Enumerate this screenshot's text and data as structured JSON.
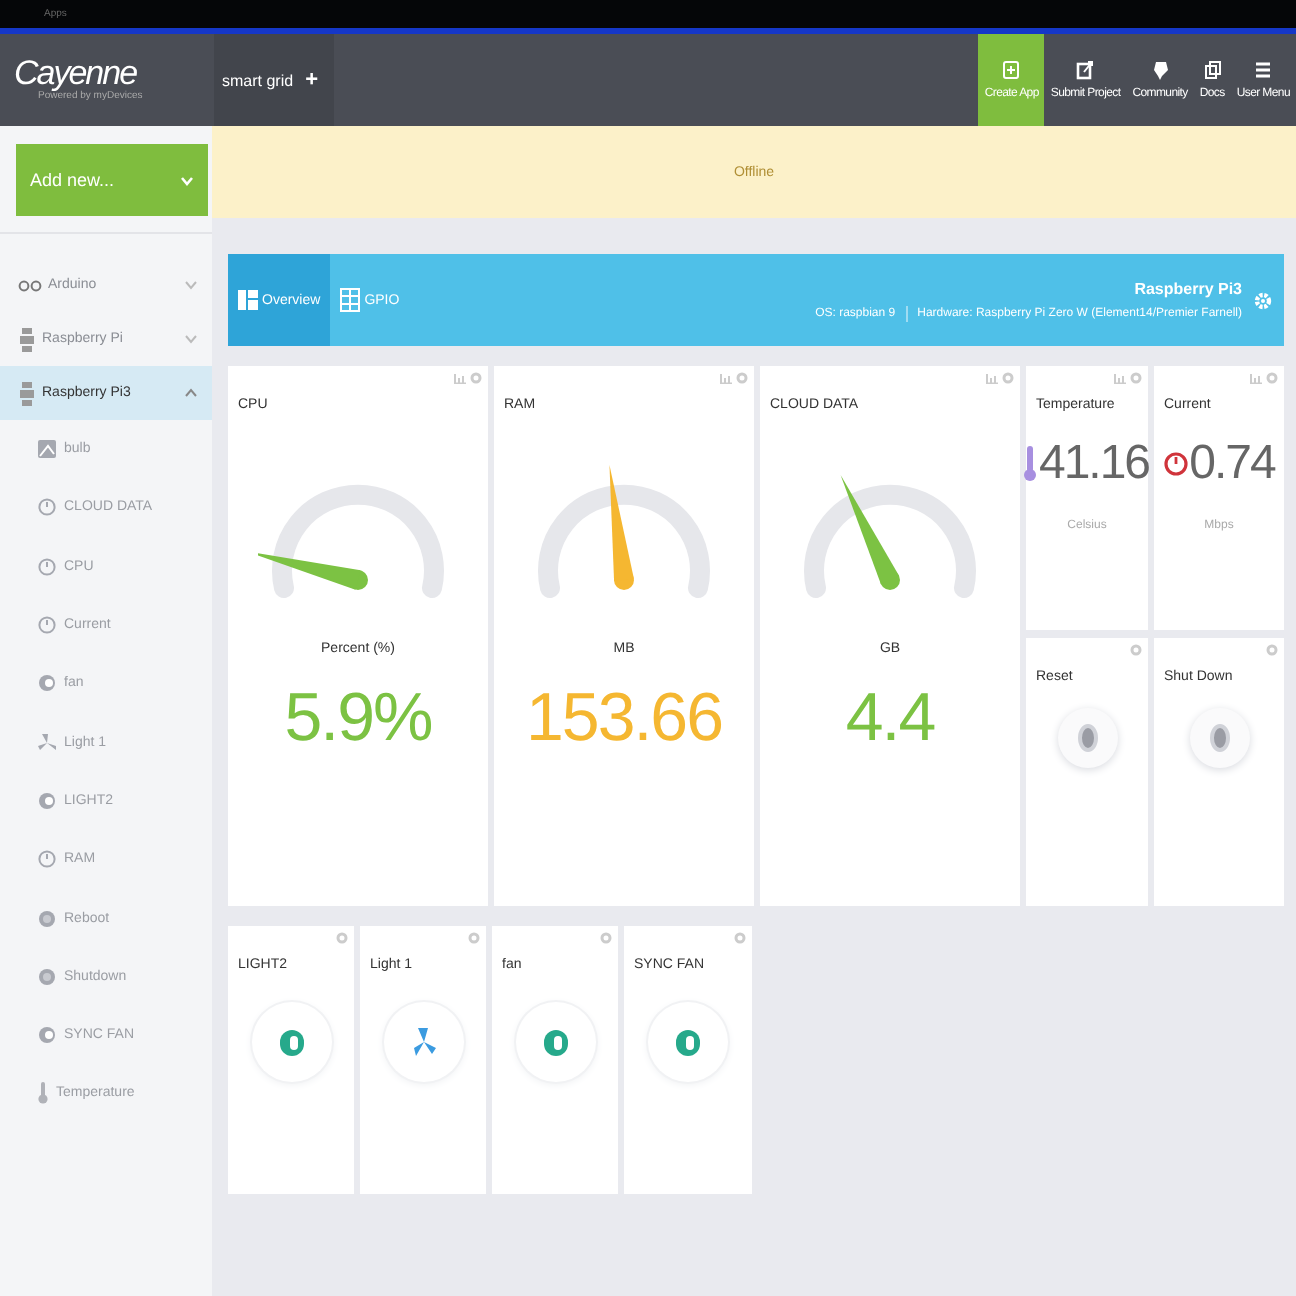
{
  "top_bar": {
    "label": "Apps"
  },
  "header": {
    "logo": "Cayenne",
    "tagline": "Powered by myDevices",
    "project_tab": "smart grid",
    "add_symbol": "+",
    "nav": [
      {
        "label": "Create App",
        "kind": "create",
        "selected": true
      },
      {
        "label": "Submit Project",
        "kind": "submit",
        "selected": false
      },
      {
        "label": "Community",
        "kind": "community",
        "selected": false
      },
      {
        "label": "Docs",
        "kind": "docs",
        "selected": false
      },
      {
        "label": "User Menu",
        "kind": "menu",
        "selected": false
      }
    ]
  },
  "sidebar": {
    "add_button": "Add new...",
    "devices": [
      {
        "name": "Arduino",
        "kind": "arduino",
        "expanded": false,
        "selected": false
      },
      {
        "name": "Raspberry Pi",
        "kind": "raspberry",
        "expanded": false,
        "selected": false
      },
      {
        "name": "Raspberry Pi3",
        "kind": "raspberry",
        "expanded": true,
        "selected": true,
        "children": [
          {
            "name": "bulb",
            "kind": "image"
          },
          {
            "name": "CLOUD DATA",
            "kind": "dial"
          },
          {
            "name": "CPU",
            "kind": "dial"
          },
          {
            "name": "Current",
            "kind": "dial"
          },
          {
            "name": "fan",
            "kind": "toggle"
          },
          {
            "name": "Light 1",
            "kind": "fan"
          },
          {
            "name": "LIGHT2",
            "kind": "toggle"
          },
          {
            "name": "RAM",
            "kind": "dial"
          },
          {
            "name": "Reboot",
            "kind": "button"
          },
          {
            "name": "Shutdown",
            "kind": "button"
          },
          {
            "name": "SYNC FAN",
            "kind": "toggle"
          },
          {
            "name": "Temperature",
            "kind": "thermo"
          }
        ]
      }
    ]
  },
  "banner": {
    "text": "Offline"
  },
  "device_bar": {
    "tabs": [
      {
        "label": "Overview",
        "kind": "overview",
        "selected": true
      },
      {
        "label": "GPIO",
        "kind": "gpio",
        "selected": false
      }
    ],
    "device_name": "Raspberry Pi3",
    "os": "OS: raspbian 9",
    "hardware": "Hardware: Raspberry Pi Zero W (Element14/Premier Farnell)"
  },
  "widgets": [
    {
      "kind": "gauge",
      "title": "CPU",
      "unit": "Percent (%)",
      "value": "5.9%",
      "color": "#7cc243"
    },
    {
      "kind": "gauge",
      "title": "RAM",
      "unit": "MB",
      "value": "153.66",
      "color": "#f5b731"
    },
    {
      "kind": "gauge",
      "title": "CLOUD DATA",
      "unit": "GB",
      "value": "4.4",
      "color": "#7cc243"
    },
    {
      "kind": "thermometer",
      "title": "Temperature",
      "value": "41.16",
      "unit": "Celsius"
    },
    {
      "kind": "meter",
      "title": "Current",
      "value": "0.74",
      "unit": "Mbps"
    },
    {
      "kind": "button",
      "title": "Reset"
    },
    {
      "kind": "button",
      "title": "Shut Down"
    }
  ],
  "actuators": [
    {
      "kind": "toggle",
      "title": "LIGHT2"
    },
    {
      "kind": "fan",
      "title": "Light 1"
    },
    {
      "kind": "toggle",
      "title": "fan"
    },
    {
      "kind": "toggle",
      "title": "SYNC FAN"
    }
  ]
}
